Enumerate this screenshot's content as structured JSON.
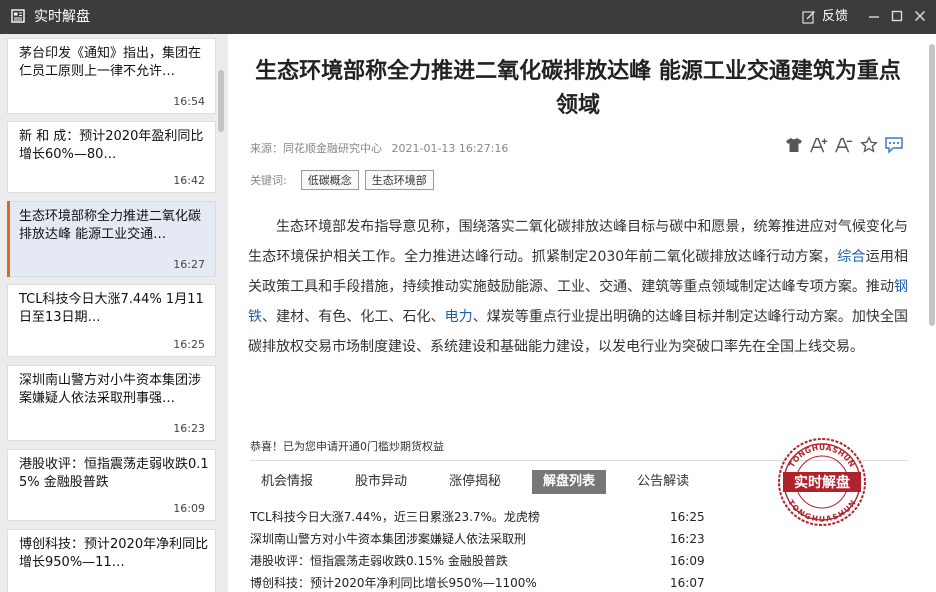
{
  "window": {
    "title": "实时解盘",
    "feedback_label": "反馈"
  },
  "sidebar": {
    "items": [
      {
        "text": "茅台印发《通知》指出，集团在仁员工原则上一律不允许…",
        "time": "16:54",
        "active": false
      },
      {
        "text": "新 和 成：预计2020年盈利同比增长60%—80…",
        "time": "16:42",
        "active": false
      },
      {
        "text": "生态环境部称全力推进二氧化碳排放达峰 能源工业交通…",
        "time": "16:27",
        "active": true
      },
      {
        "text": "TCL科技今日大涨7.44% 1月11日至13日期…",
        "time": "16:25",
        "active": false
      },
      {
        "text": "深圳南山警方对小牛资本集团涉案嫌疑人依法采取刑事强…",
        "time": "16:23",
        "active": false
      },
      {
        "text": "港股收评：恒指震荡走弱收跌0.15% 金融股普跌",
        "time": "16:09",
        "active": false
      },
      {
        "text": "博创科技：预计2020年净利同比增长950%—11…",
        "time": "",
        "active": false
      }
    ]
  },
  "article": {
    "title": "生态环境部称全力推进二氧化碳排放达峰 能源工业交通建筑为重点领域",
    "source": "来源：同花顺金融研究中心",
    "datetime": "2021-01-13 16:27:16",
    "keywords_label": "关键词:",
    "keywords": [
      "低碳概念",
      "生态环境部"
    ],
    "body": {
      "p1": "生态环境部发布指导意见称，围绕落实二氧化碳排放达峰目标与碳中和愿景，统筹推进应对气候变化与生态环境保护相关工作。全力推进达峰行动。抓紧制定2030年前二氧化碳排放达峰行动方案，",
      "link1": "综合",
      "p2": "运用相关政策工具和手段措施，持续推动实施鼓励能源、工业、交通、建筑等重点领域制定达峰专项方案。推动",
      "link2": "钢铁",
      "p3": "、建材、有色、化工、石化、",
      "link3": "电力",
      "p4": "、煤炭等重点行业提出明确的达峰目标并制定达峰行动方案。加快全国碳排放权交易市场制度建设、系统建设和基础能力建设，以发电行业为突破口率先在全国上线交易。"
    }
  },
  "promo": "恭喜！已为您申请开通0门槛炒期货权益",
  "tabs": [
    {
      "label": "机会情报",
      "active": false
    },
    {
      "label": "股市异动",
      "active": false
    },
    {
      "label": "涨停揭秘",
      "active": false
    },
    {
      "label": "解盘列表",
      "active": true
    },
    {
      "label": "公告解读",
      "active": false
    }
  ],
  "news_list": [
    {
      "title": "TCL科技今日大涨7.44%，近三日累涨23.7%。龙虎榜",
      "time": "16:25"
    },
    {
      "title": "深圳南山警方对小牛资本集团涉案嫌疑人依法采取刑",
      "time": "16:23"
    },
    {
      "title": "港股收评：恒指震荡走弱收跌0.15% 金融股普跌",
      "time": "16:09"
    },
    {
      "title": "博创科技：预计2020年净利同比增长950%—1100%",
      "time": "16:07"
    }
  ],
  "stamp": {
    "top_text": "TONGHUASHUN",
    "center_text": "实时解盘",
    "bottom_text": "TONGHUASHUN"
  },
  "colors": {
    "titlebar": "#3c3c3c",
    "accent": "#e4632c",
    "link": "#1f5fae",
    "stamp_red": "#b0232d"
  },
  "icons": {
    "app": "newspaper-icon",
    "feedback": "edit-icon",
    "minimize": "minimize-icon",
    "maximize": "maximize-icon",
    "close": "close-icon",
    "skin": "tshirt-icon",
    "font_up": "font-increase-icon",
    "font_down": "font-decrease-icon",
    "favorite": "star-icon",
    "comment": "comment-icon"
  }
}
